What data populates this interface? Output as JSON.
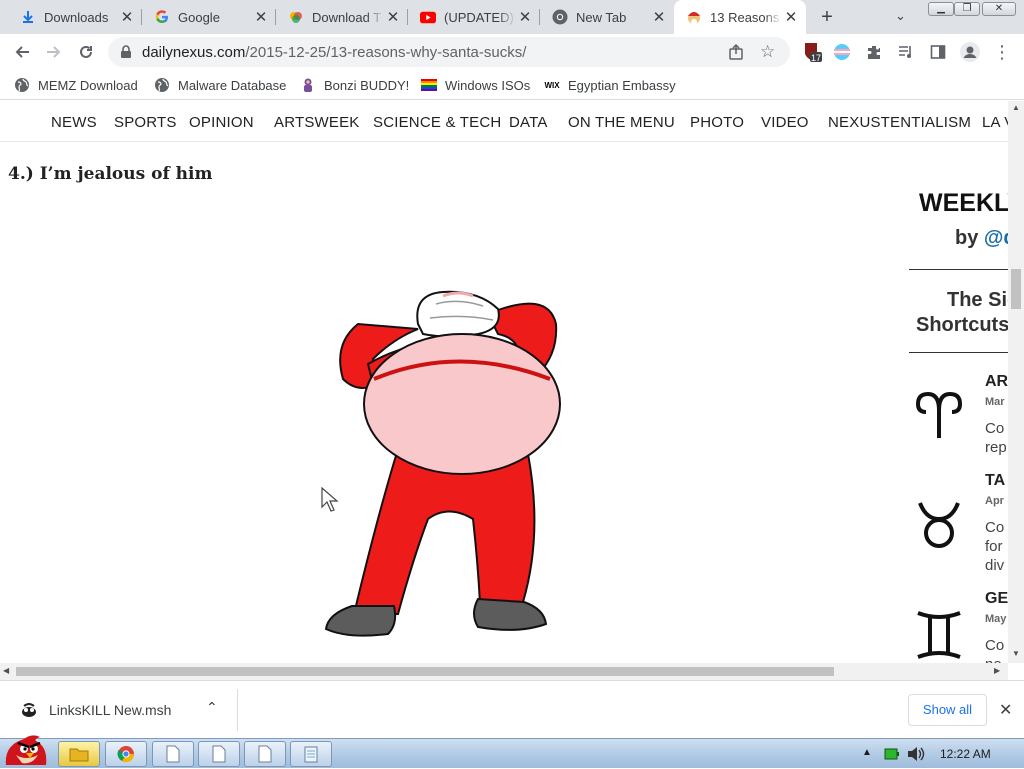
{
  "tabs": [
    {
      "title": "Downloads",
      "icon": "download-icon"
    },
    {
      "title": "Google",
      "icon": "google-icon"
    },
    {
      "title": "Download T",
      "icon": "colorful-logo-icon"
    },
    {
      "title": "(UPDATED)",
      "icon": "youtube-icon"
    },
    {
      "title": "New Tab",
      "icon": "chrome-icon"
    },
    {
      "title": "13 Reasons",
      "icon": "santa-icon"
    }
  ],
  "new_tab_symbol": "+",
  "address": {
    "domain": "dailynexus.com",
    "path": "/2015-12-25/13-reasons-why-santa-sucks/"
  },
  "extension_badge": "17",
  "bookmarks": [
    {
      "label": "MEMZ Download",
      "icon": "globe-icon"
    },
    {
      "label": "Malware Database",
      "icon": "globe-icon"
    },
    {
      "label": "Bonzi BUDDY!",
      "icon": "bonzi-icon"
    },
    {
      "label": "Windows ISOs",
      "icon": "rainbow-flag-icon"
    },
    {
      "label": "Egyptian Embassy",
      "icon": "wix-icon"
    }
  ],
  "wix_text": "WIX",
  "site_nav": [
    "NEWS",
    "SPORTS",
    "OPINION",
    "ARTSWEEK",
    "SCIENCE & TECH",
    "DATA",
    "ON THE MENU",
    "PHOTO",
    "VIDEO",
    "NEXUSTENTIALISM",
    "LA V"
  ],
  "article": {
    "heading": "4.) I’m jealous of him",
    "image": "dancing-santa-illustration"
  },
  "sidebar": {
    "title": "WEEKLY",
    "by_prefix": "by ",
    "by_handle": "@d",
    "subtitle_line1": "The Sig",
    "subtitle_line2": "Shortcuts",
    "signs": [
      {
        "name": "AR",
        "date": "Mar",
        "text": [
          "Co",
          "rep"
        ],
        "symbol": "♈"
      },
      {
        "name": "TA",
        "date": "Apr",
        "text": [
          "Co",
          "for",
          "div"
        ],
        "symbol": "♉"
      },
      {
        "name": "GE",
        "date": "May",
        "text": [
          "Co",
          "no"
        ],
        "symbol": "♊"
      }
    ]
  },
  "download": {
    "filename": "LinksKILL New.msh",
    "show_all": "Show all"
  },
  "taskbar": {
    "clock": "12:22 AM"
  },
  "colors": {
    "tab_strip": "#dee1e6",
    "accent": "#1a73e8",
    "santa_red": "#ee1b1b",
    "belly": "#f9c8cb"
  }
}
